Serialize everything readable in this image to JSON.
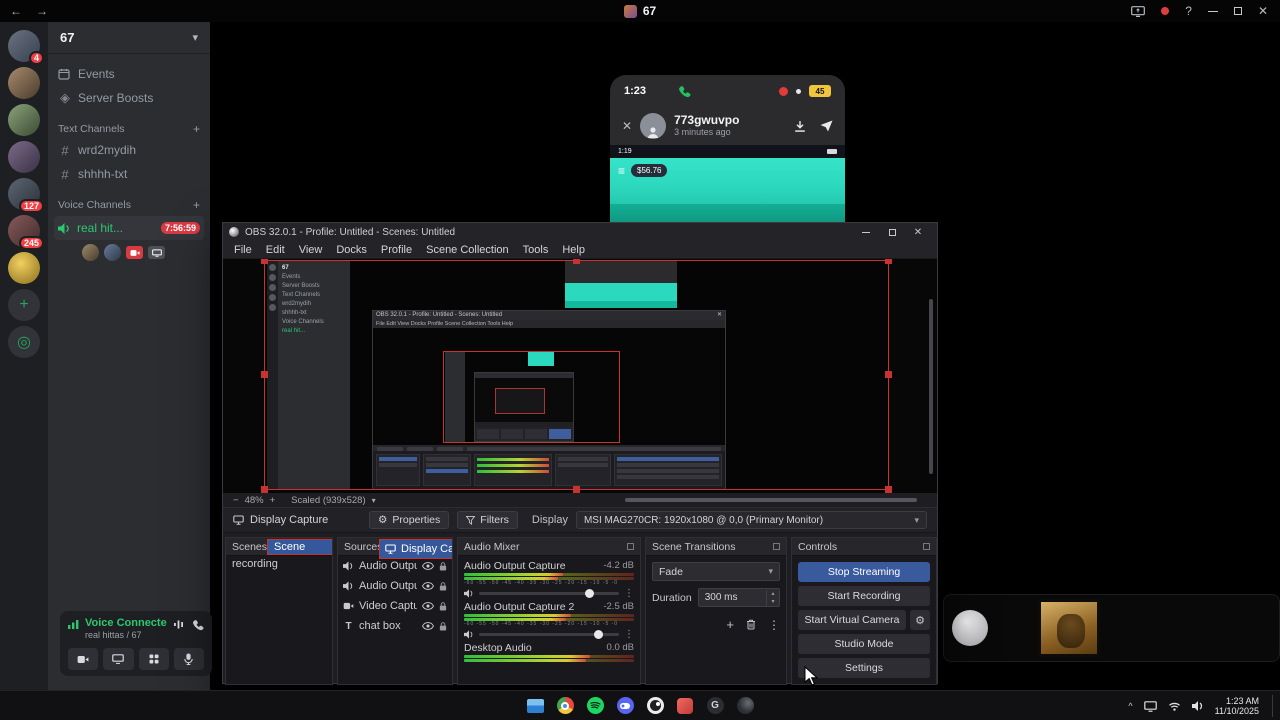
{
  "icons": {
    "back": "←",
    "forward": "→",
    "close": "✕",
    "help": "?",
    "chevron_down": "▾",
    "chevron_up": "▴",
    "plus": "+",
    "minus": "−",
    "kebab": "⋮",
    "hash": "#",
    "hamburger": "≡",
    "gear": "⚙",
    "caret": "^",
    "boost": "◈",
    "compass": "◎",
    "text_source": "T",
    "g_logo": "G"
  },
  "topbar": {
    "title": "67"
  },
  "discord": {
    "server": {
      "name": "67",
      "badges": [
        "4",
        "127",
        "245"
      ]
    },
    "nav": {
      "events": "Events",
      "boosts": "Server Boosts"
    },
    "text_channels": {
      "label": "Text Channels",
      "items": [
        "wrd2mydih",
        "shhhh-txt"
      ]
    },
    "voice_channels": {
      "label": "Voice Channels",
      "items": [
        {
          "name": "real hit...",
          "timer": "7:56:59"
        }
      ]
    },
    "footer": {
      "status": "Voice Connecte",
      "detail": "real hittas / 67"
    }
  },
  "phone": {
    "status_time": "1:23",
    "battery": "45",
    "notification": {
      "username": "773gwuvpo",
      "timestamp": "3 minutes ago"
    },
    "screen": {
      "mini_time": "1:19",
      "price": "$56.76"
    }
  },
  "obs": {
    "window_title": "OBS 32.0.1 - Profile: Untitled - Scenes: Untitled",
    "menu": [
      "File",
      "Edit",
      "View",
      "Docks",
      "Profile",
      "Scene Collection",
      "Tools",
      "Help"
    ],
    "menu_inline": "File  Edit  View  Docks  Profile  Scene Collection  Tools  Help",
    "statusbar": {
      "zoom": "48%",
      "scale": "Scaled (939x528)"
    },
    "source_toolbar": {
      "source_name": "Display Capture",
      "properties": "Properties",
      "filters": "Filters",
      "display_label": "Display",
      "display_value": "MSI MAG270CR: 1920x1080 @ 0,0 (Primary Monitor)"
    },
    "scenes": {
      "title": "Scenes",
      "items": [
        "Scene",
        "recording"
      ]
    },
    "sources": {
      "title": "Sources",
      "items": [
        {
          "name": "Audio Outpu"
        },
        {
          "name": "Audio Outpu"
        },
        {
          "name": "Video Captur"
        },
        {
          "name": "chat box"
        },
        {
          "name": "Display Capt"
        }
      ]
    },
    "mixer": {
      "title": "Audio Mixer",
      "scale_ticks": "-60 -55 -50 -45 -40 -35 -30 -25 -20 -15 -10 -5 -0",
      "channels": [
        {
          "name": "Audio Output Capture",
          "level": "-4.2 dB"
        },
        {
          "name": "Audio Output Capture 2",
          "level": "-2.5 dB"
        },
        {
          "name": "Desktop Audio",
          "level": "0.0 dB"
        }
      ]
    },
    "transitions": {
      "title": "Scene Transitions",
      "transition": "Fade",
      "duration_label": "Duration",
      "duration_value": "300 ms"
    },
    "controls": {
      "title": "Controls",
      "stop_streaming": "Stop Streaming",
      "start_recording": "Start Recording",
      "virtual_camera": "Start Virtual Camera",
      "studio_mode": "Studio Mode",
      "settings": "Settings"
    }
  },
  "taskbar": {
    "clock_time": "1:23 AM",
    "clock_date": "11/10/2025"
  }
}
